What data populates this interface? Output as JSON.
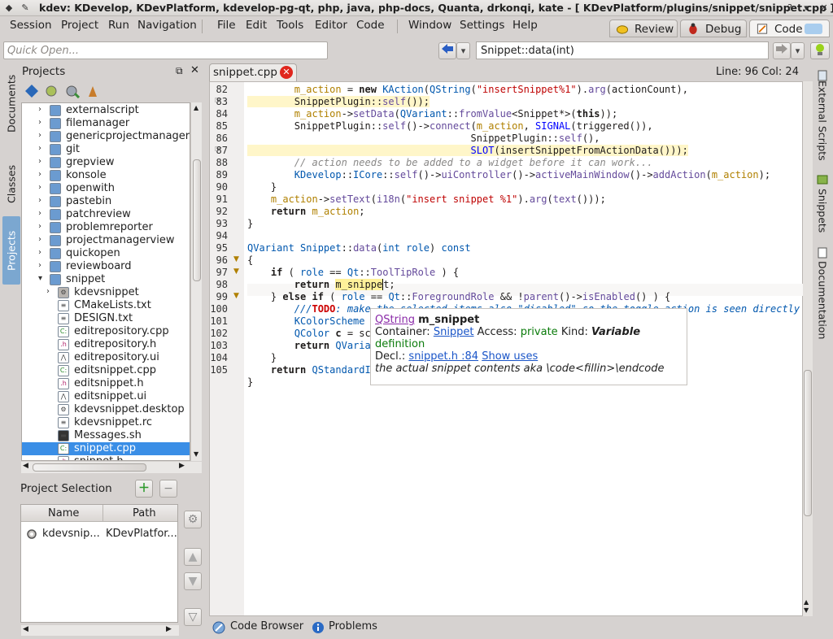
{
  "window": {
    "title": "kdev:  KDevelop, KDevPlatform, kdevelop-pg-qt, php, java, php-docs, Quanta, drkonqi, kate - [ KDevPlatform/plugins/snippet/snippet.cpp ] -..."
  },
  "menu": {
    "items": [
      "Session",
      "Project",
      "Run",
      "Navigation",
      "File",
      "Edit",
      "Tools",
      "Editor",
      "Code",
      "Window",
      "Settings",
      "Help"
    ]
  },
  "areas": [
    {
      "label": "Review",
      "icon": "review-icon"
    },
    {
      "label": "Debug",
      "icon": "bug-icon"
    },
    {
      "label": "Code",
      "icon": "edit-icon",
      "active": true
    }
  ],
  "quickopen": {
    "placeholder": "Quick Open..."
  },
  "context": {
    "value": "Snippet::data(int)"
  },
  "leftdock": {
    "tabs": [
      "Documents",
      "Classes",
      "Projects"
    ]
  },
  "rightdock": {
    "tabs": [
      "External Scripts",
      "Snippets",
      "Documentation"
    ]
  },
  "projects": {
    "title": "Projects",
    "tree": [
      {
        "label": "externalscript",
        "type": "folder",
        "expander": "collapsed",
        "level": 1
      },
      {
        "label": "filemanager",
        "type": "folder",
        "expander": "collapsed",
        "level": 1
      },
      {
        "label": "genericprojectmanager",
        "type": "folder",
        "expander": "collapsed",
        "level": 1
      },
      {
        "label": "git",
        "type": "folder",
        "expander": "collapsed",
        "level": 1
      },
      {
        "label": "grepview",
        "type": "folder",
        "expander": "collapsed",
        "level": 1
      },
      {
        "label": "konsole",
        "type": "folder",
        "expander": "collapsed",
        "level": 1
      },
      {
        "label": "openwith",
        "type": "folder",
        "expander": "collapsed",
        "level": 1
      },
      {
        "label": "pastebin",
        "type": "folder",
        "expander": "collapsed",
        "level": 1
      },
      {
        "label": "patchreview",
        "type": "folder",
        "expander": "collapsed",
        "level": 1
      },
      {
        "label": "problemreporter",
        "type": "folder",
        "expander": "collapsed",
        "level": 1
      },
      {
        "label": "projectmanagerview",
        "type": "folder",
        "expander": "collapsed",
        "level": 1
      },
      {
        "label": "quickopen",
        "type": "folder",
        "expander": "collapsed",
        "level": 1
      },
      {
        "label": "reviewboard",
        "type": "folder",
        "expander": "collapsed",
        "level": 1
      },
      {
        "label": "snippet",
        "type": "folder",
        "expander": "expanded",
        "level": 1
      },
      {
        "label": "kdevsnippet",
        "type": "target",
        "expander": "collapsed",
        "level": 2
      },
      {
        "label": "CMakeLists.txt",
        "type": "text",
        "level": 2
      },
      {
        "label": "DESIGN.txt",
        "type": "text",
        "level": 2
      },
      {
        "label": "editrepository.cpp",
        "type": "cpp",
        "level": 2
      },
      {
        "label": "editrepository.h",
        "type": "h",
        "level": 2
      },
      {
        "label": "editrepository.ui",
        "type": "ui",
        "level": 2
      },
      {
        "label": "editsnippet.cpp",
        "type": "cpp",
        "level": 2
      },
      {
        "label": "editsnippet.h",
        "type": "h",
        "level": 2
      },
      {
        "label": "editsnippet.ui",
        "type": "ui",
        "level": 2
      },
      {
        "label": "kdevsnippet.desktop",
        "type": "desktop",
        "level": 2
      },
      {
        "label": "kdevsnippet.rc",
        "type": "text",
        "level": 2
      },
      {
        "label": "Messages.sh",
        "type": "sh",
        "level": 2
      },
      {
        "label": "snippet.cpp",
        "type": "cpp",
        "level": 2,
        "selected": true
      },
      {
        "label": "snippet.h",
        "type": "h",
        "level": 2
      }
    ]
  },
  "projectSelection": {
    "title": "Project Selection",
    "columns": [
      "Name",
      "Path"
    ],
    "rows": [
      {
        "name": "kdevsnip...",
        "path": "KDevPlatfor..."
      }
    ]
  },
  "editor": {
    "tab": "snippet.cpp",
    "position": "Line: 96 Col: 24",
    "lines": [
      82,
      83,
      84,
      85,
      86,
      87,
      88,
      89,
      90,
      91,
      92,
      93,
      94,
      95,
      96,
      97,
      98,
      99,
      100,
      101,
      102,
      103,
      104,
      105
    ]
  },
  "tooltip": {
    "type": "QString",
    "name": "m_snippet",
    "containerLabel": "Container:",
    "container": "Snippet",
    "accessLabel": "Access:",
    "access": "private",
    "kindLabel": "Kind:",
    "kind": "Variable",
    "kindExtra": "definition",
    "declLabel": "Decl.:",
    "decl": "snippet.h :84",
    "showUses": "Show uses",
    "comment": "the actual snippet contents aka \\code<fillin>\\endcode"
  },
  "bottom": {
    "tabs": [
      {
        "label": "Code Browser",
        "icon": "code-browser-icon"
      },
      {
        "label": "Problems",
        "icon": "info-icon"
      }
    ]
  }
}
